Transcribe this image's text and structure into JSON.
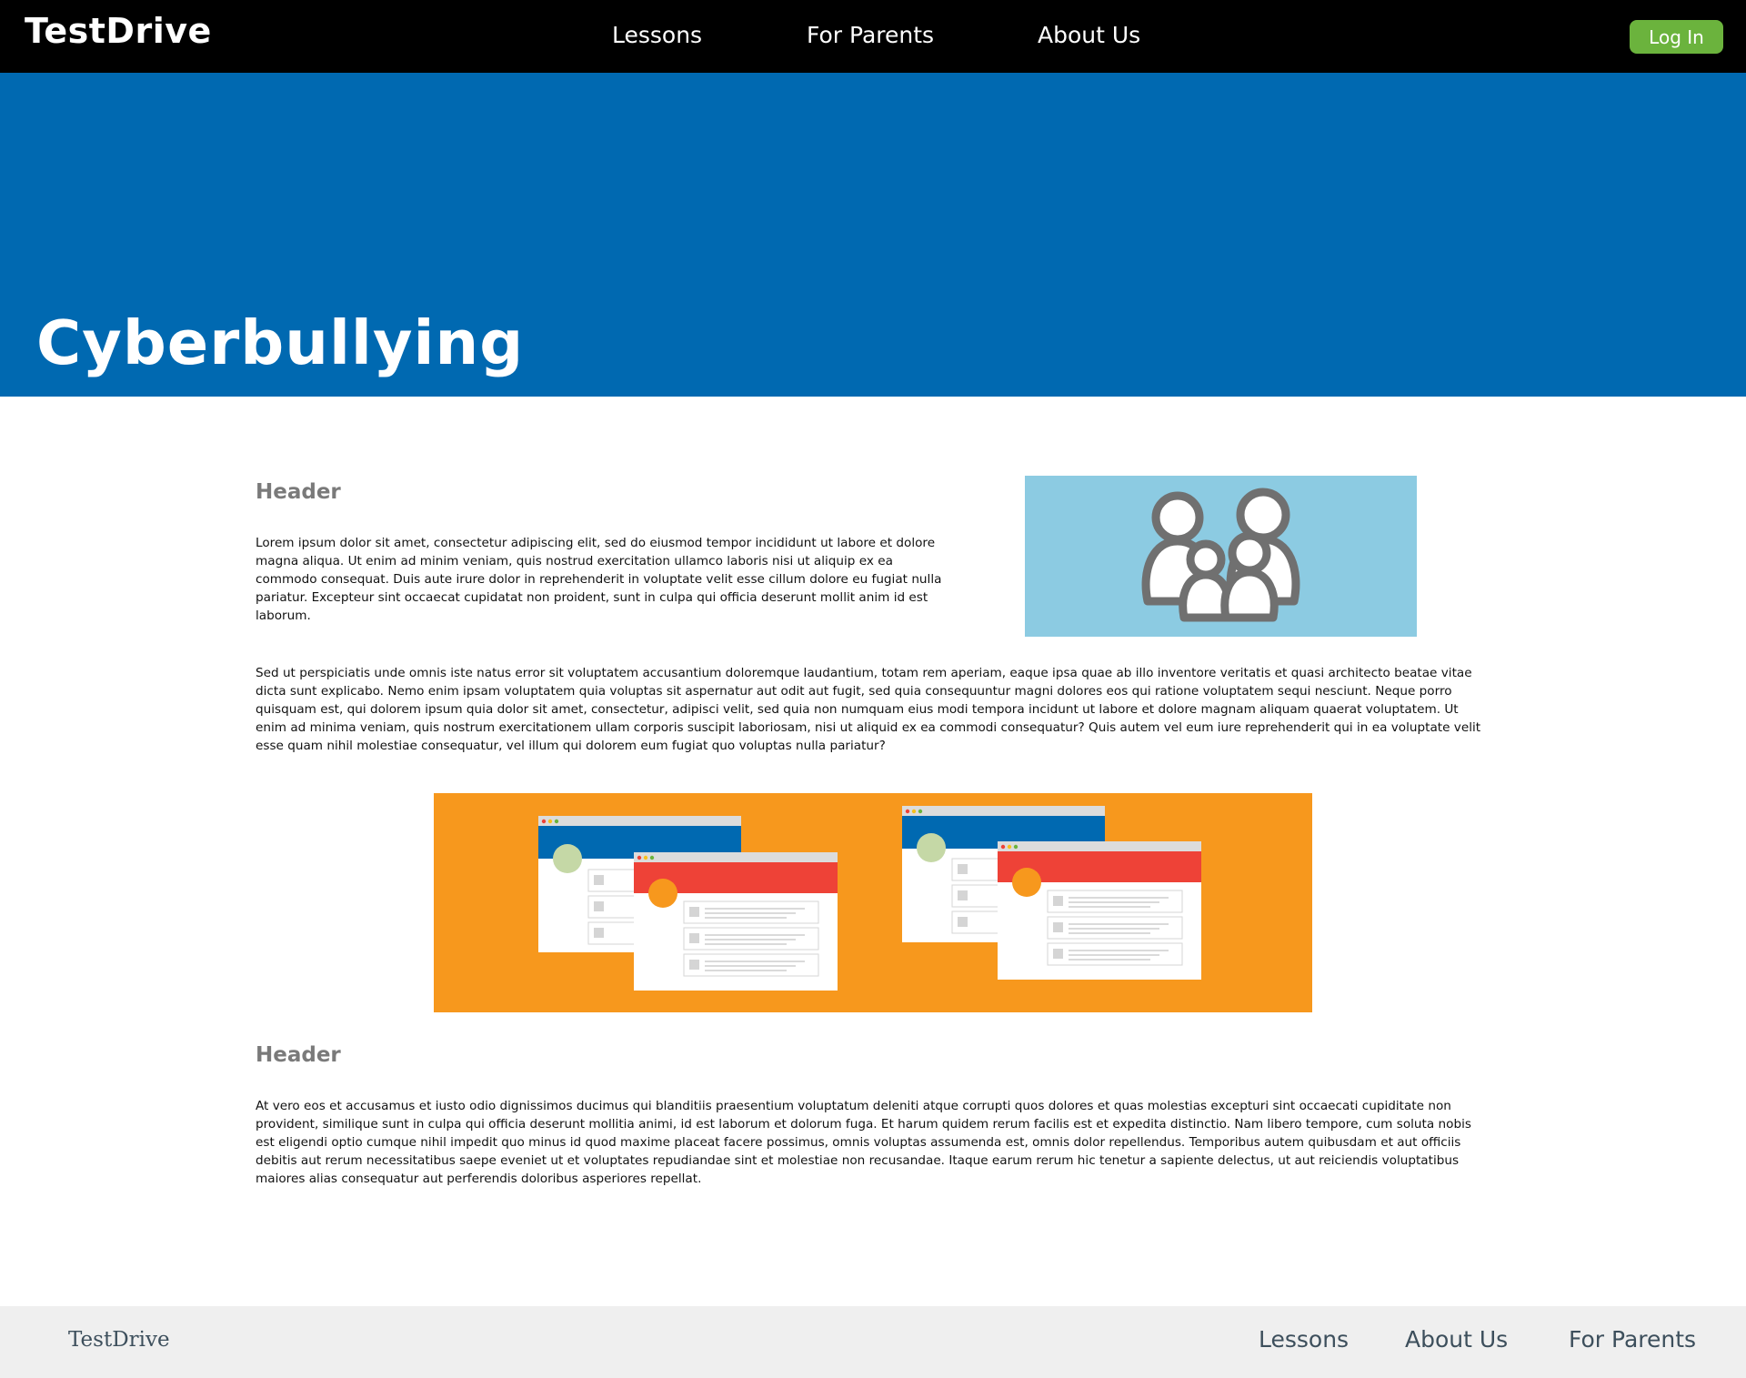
{
  "nav": {
    "brand": "TestDrive",
    "links": [
      "Lessons",
      "For Parents",
      "About Us"
    ],
    "login_label": "Log In"
  },
  "hero": {
    "title": "Cyberbullying"
  },
  "content": {
    "section1": {
      "header": "Header",
      "para1": "Lorem ipsum dolor sit amet, consectetur adipiscing elit, sed do eiusmod tempor incididunt ut labore et dolore magna aliqua. Ut enim ad minim veniam, quis nostrud exercitation ullamco laboris nisi ut aliquip ex ea commodo consequat. Duis aute irure dolor in reprehenderit in voluptate velit esse cillum dolore eu fugiat nulla pariatur. Excepteur sint occaecat cupidatat non proident, sunt in culpa qui officia deserunt mollit anim id est laborum.",
      "para2": "Sed ut perspiciatis unde omnis iste natus error sit voluptatem accusantium doloremque laudantium, totam rem aperiam, eaque ipsa quae ab illo inventore veritatis et quasi architecto beatae vitae dicta sunt explicabo. Nemo enim ipsam voluptatem quia voluptas sit aspernatur aut odit aut fugit, sed quia consequuntur magni dolores eos qui ratione voluptatem sequi nesciunt. Neque porro quisquam est, qui dolorem ipsum quia dolor sit amet, consectetur, adipisci velit, sed quia non numquam eius modi tempora incidunt ut labore et dolore magnam aliquam quaerat voluptatem. Ut enim ad minima veniam, quis nostrum exercitationem ullam corporis suscipit laboriosam, nisi ut aliquid ex ea commodi consequatur? Quis autem vel eum iure reprehenderit qui in ea voluptate velit esse quam nihil molestiae consequatur, vel illum qui dolorem eum fugiat quo voluptas nulla pariatur?"
    },
    "section2": {
      "header": "Header",
      "para": "At vero eos et accusamus et iusto odio dignissimos ducimus qui blanditiis praesentium voluptatum deleniti atque corrupti quos dolores et quas molestias excepturi sint occaecati cupiditate non provident, similique sunt in culpa qui officia deserunt mollitia animi, id est laborum et dolorum fuga. Et harum quidem rerum facilis est et expedita distinctio. Nam libero tempore, cum soluta nobis est eligendi optio cumque nihil impedit quo minus id quod maxime placeat facere possimus, omnis voluptas assumenda est, omnis dolor repellendus. Temporibus autem quibusdam et aut officiis debitis aut rerum necessitatibus saepe eveniet ut et voluptates repudiandae sint et molestiae non recusandae. Itaque earum rerum hic tenetur a sapiente delectus, ut aut reiciendis voluptatibus maiores alias consequatur aut perferendis doloribus asperiores repellat."
    }
  },
  "footer": {
    "brand": "TestDrive",
    "links": [
      "Lessons",
      "About Us",
      "For Parents"
    ]
  },
  "images": {
    "family_icon": "family-group-icon",
    "windows_illustration": "social-media-windows-illustration"
  },
  "colors": {
    "nav_bg": "#000000",
    "hero_bg": "#0069b1",
    "login_green": "#6bb33d",
    "family_bg": "#8ccbe2",
    "windows_bg": "#f7981d",
    "footer_bg": "#efefef",
    "footer_text": "#3d4f5c"
  }
}
